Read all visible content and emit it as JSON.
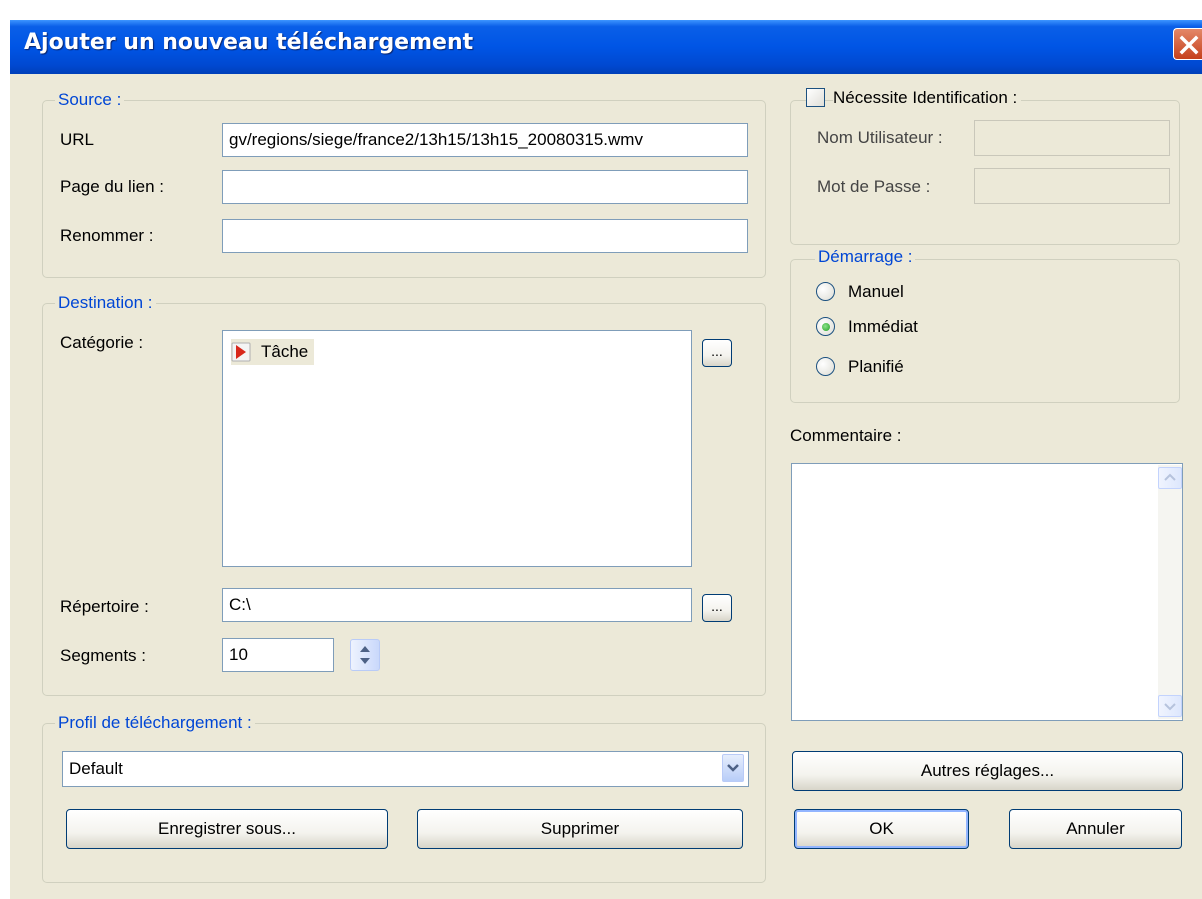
{
  "window": {
    "title": "Ajouter un nouveau téléchargement"
  },
  "source": {
    "legend": "Source :",
    "url_label": "URL",
    "url_value": "gv/regions/siege/france2/13h15/13h15_20080315.wmv",
    "page_label": "Page du lien :",
    "page_value": "",
    "rename_label": "Renommer :",
    "rename_value": ""
  },
  "auth": {
    "checkbox_label": "Nécessite Identification :",
    "checked": false,
    "username_label": "Nom Utilisateur :",
    "username_value": "",
    "password_label": "Mot de Passe :",
    "password_value": ""
  },
  "destination": {
    "legend": "Destination :",
    "category_label": "Catégorie :",
    "categories": [
      {
        "label": "Tâche",
        "icon": "task-category-icon"
      }
    ],
    "browse_label": "...",
    "directory_label": "Répertoire :",
    "directory_value": "C:\\",
    "segments_label": "Segments :",
    "segments_value": "10"
  },
  "startup": {
    "legend": "Démarrage :",
    "options": [
      "Manuel",
      "Immédiat",
      "Planifié"
    ],
    "selected": "Immédiat"
  },
  "comment": {
    "label": "Commentaire :",
    "value": ""
  },
  "profile": {
    "legend": "Profil de téléchargement :",
    "selected": "Default",
    "save_as_label": "Enregistrer sous...",
    "delete_label": "Supprimer"
  },
  "buttons": {
    "other_settings": "Autres réglages...",
    "ok": "OK",
    "cancel": "Annuler"
  },
  "colors": {
    "titlebar": "#0055e5",
    "dialog_bg": "#ece9d8",
    "legend_text": "#0046d5",
    "close_button": "#c6401c"
  }
}
